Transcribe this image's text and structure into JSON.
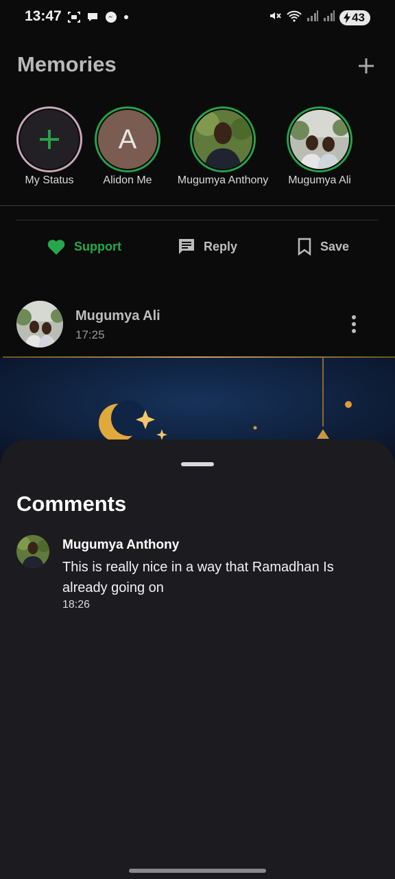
{
  "status_bar": {
    "time": "13:47",
    "battery": "43",
    "left_icons": [
      "screenshot-icon",
      "chat-bubble-icon",
      "messenger-icon",
      "dot-icon"
    ],
    "right_icons": [
      "mute-icon",
      "wifi-icon",
      "signal-icon",
      "signal-icon",
      "charging-icon"
    ]
  },
  "header": {
    "title": "Memories",
    "add_icon": "plus-icon"
  },
  "stories": [
    {
      "label": "My Status",
      "type": "add",
      "ring_color": "#c9a7b8"
    },
    {
      "label": "Alidon Me",
      "type": "initial",
      "initial": "A",
      "ring_color": "#27a148"
    },
    {
      "label": "Mugumya Anthony",
      "type": "photo",
      "ring_color": "#27a148"
    },
    {
      "label": "Mugumya Ali",
      "type": "photo",
      "ring_color": "#27a148"
    }
  ],
  "actions": {
    "support": "Support",
    "reply": "Reply",
    "save": "Save"
  },
  "post": {
    "author": "Mugumya Ali",
    "time": "17:25"
  },
  "comments_sheet": {
    "title": "Comments",
    "comments": [
      {
        "author": "Mugumya Anthony",
        "text": "This is really nice in a way that Ramadhan Is already going on",
        "time": "18:26"
      }
    ]
  },
  "colors": {
    "accent_green": "#26a84a",
    "sheet_bg": "#1c1b1f",
    "page_bg": "#0b0b0c"
  }
}
